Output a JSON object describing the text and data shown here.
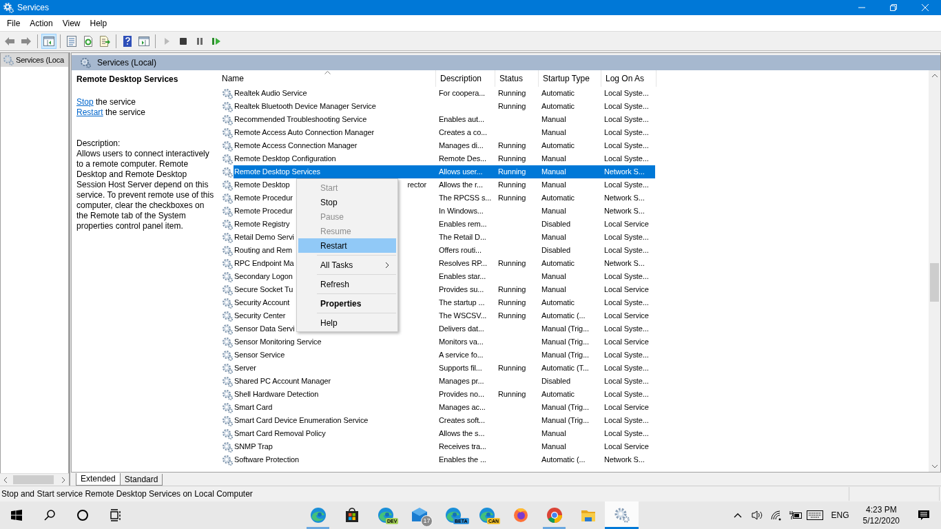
{
  "window": {
    "title": "Services"
  },
  "menu": [
    "File",
    "Action",
    "View",
    "Help"
  ],
  "toolbar": [
    {
      "kind": "back",
      "disabled": false,
      "pressed": false
    },
    {
      "kind": "forward",
      "disabled": false,
      "pressed": false
    },
    {
      "kind": "sep"
    },
    {
      "kind": "tree",
      "disabled": false,
      "pressed": true
    },
    {
      "kind": "sep"
    },
    {
      "kind": "props",
      "disabled": false,
      "pressed": false
    },
    {
      "kind": "refresh",
      "disabled": false,
      "pressed": false
    },
    {
      "kind": "export",
      "disabled": false,
      "pressed": false
    },
    {
      "kind": "sep"
    },
    {
      "kind": "help",
      "disabled": false,
      "pressed": false
    },
    {
      "kind": "pane",
      "disabled": false,
      "pressed": false
    },
    {
      "kind": "sep"
    },
    {
      "kind": "play",
      "disabled": true,
      "pressed": false
    },
    {
      "kind": "stop",
      "disabled": false,
      "pressed": false
    },
    {
      "kind": "pause",
      "disabled": false,
      "pressed": false
    },
    {
      "kind": "resume",
      "disabled": false,
      "pressed": false
    }
  ],
  "tree": {
    "items": [
      {
        "label": "Services (Loca",
        "selected": true
      }
    ]
  },
  "pane_header": "Services (Local)",
  "details": {
    "title": "Remote Desktop Services",
    "actions": [
      {
        "link": "Stop",
        "text": "the service"
      },
      {
        "link": "Restart",
        "text": "the service"
      }
    ],
    "description_label": "Description:",
    "description": "Allows users to connect interactively to a remote computer. Remote Desktop and Remote Desktop Session Host Server depend on this service. To prevent remote use of this computer, clear the checkboxes on the Remote tab of the System properties control panel item."
  },
  "table": {
    "columns": [
      "Name",
      "Description",
      "Status",
      "Startup Type",
      "Log On As"
    ],
    "rows": [
      {
        "name": "Realtek Audio Service",
        "description": "For coopera...",
        "status": "Running",
        "startup": "Automatic",
        "logon": "Local Syste...",
        "selected": false
      },
      {
        "name": "Realtek Bluetooth Device Manager Service",
        "status": "Running",
        "startup": "Automatic",
        "logon": "Local Syste...",
        "selected": false
      },
      {
        "name": "Recommended Troubleshooting Service",
        "description": "Enables aut...",
        "startup": "Manual",
        "logon": "Local Syste...",
        "selected": false
      },
      {
        "name": "Remote Access Auto Connection Manager",
        "description": "Creates a co...",
        "startup": "Manual",
        "logon": "Local Syste...",
        "selected": false
      },
      {
        "name": "Remote Access Connection Manager",
        "description": "Manages di...",
        "status": "Running",
        "startup": "Automatic",
        "logon": "Local Syste...",
        "selected": false
      },
      {
        "name": "Remote Desktop Configuration",
        "description": "Remote Des...",
        "status": "Running",
        "startup": "Manual",
        "logon": "Local Syste...",
        "selected": false
      },
      {
        "name": "Remote Desktop Services",
        "description": "Allows user...",
        "status": "Running",
        "startup": "Manual",
        "logon": "Network S...",
        "selected": true
      },
      {
        "name": "Remote Desktop",
        "name_tail": "rector",
        "description": "Allows the r...",
        "status": "Running",
        "startup": "Manual",
        "logon": "Local Syste...",
        "selected": false
      },
      {
        "name": "Remote Procedur",
        "description": "The RPCSS s...",
        "status": "Running",
        "startup": "Automatic",
        "logon": "Network S...",
        "selected": false
      },
      {
        "name": "Remote Procedur",
        "description": "In Windows...",
        "startup": "Manual",
        "logon": "Network S...",
        "selected": false
      },
      {
        "name": "Remote Registry",
        "description": "Enables rem...",
        "startup": "Disabled",
        "logon": "Local Service",
        "selected": false
      },
      {
        "name": "Retail Demo Servi",
        "description": "The Retail D...",
        "startup": "Manual",
        "logon": "Local Syste...",
        "selected": false
      },
      {
        "name": "Routing and Rem",
        "description": "Offers routi...",
        "startup": "Disabled",
        "logon": "Local Syste...",
        "selected": false
      },
      {
        "name": "RPC Endpoint Ma",
        "description": "Resolves RP...",
        "status": "Running",
        "startup": "Automatic",
        "logon": "Network S...",
        "selected": false
      },
      {
        "name": "Secondary Logon",
        "description": "Enables star...",
        "startup": "Manual",
        "logon": "Local Syste...",
        "selected": false
      },
      {
        "name": "Secure Socket Tu",
        "description": "Provides su...",
        "status": "Running",
        "startup": "Manual",
        "logon": "Local Service",
        "selected": false
      },
      {
        "name": "Security Account",
        "description": "The startup ...",
        "status": "Running",
        "startup": "Automatic",
        "logon": "Local Syste...",
        "selected": false
      },
      {
        "name": "Security Center",
        "description": "The WSCSV...",
        "status": "Running",
        "startup": "Automatic (...",
        "logon": "Local Service",
        "selected": false
      },
      {
        "name": "Sensor Data Servi",
        "description": "Delivers dat...",
        "startup": "Manual (Trig...",
        "logon": "Local Syste...",
        "selected": false
      },
      {
        "name": "Sensor Monitoring Service",
        "description": "Monitors va...",
        "startup": "Manual (Trig...",
        "logon": "Local Service",
        "selected": false
      },
      {
        "name": "Sensor Service",
        "description": "A service fo...",
        "startup": "Manual (Trig...",
        "logon": "Local Syste...",
        "selected": false
      },
      {
        "name": "Server",
        "description": "Supports fil...",
        "status": "Running",
        "startup": "Automatic (T...",
        "logon": "Local Syste...",
        "selected": false
      },
      {
        "name": "Shared PC Account Manager",
        "description": "Manages pr...",
        "startup": "Disabled",
        "logon": "Local Syste...",
        "selected": false
      },
      {
        "name": "Shell Hardware Detection",
        "description": "Provides no...",
        "status": "Running",
        "startup": "Automatic",
        "logon": "Local Syste...",
        "selected": false
      },
      {
        "name": "Smart Card",
        "description": "Manages ac...",
        "startup": "Manual (Trig...",
        "logon": "Local Service",
        "selected": false
      },
      {
        "name": "Smart Card Device Enumeration Service",
        "description": "Creates soft...",
        "startup": "Manual (Trig...",
        "logon": "Local Syste...",
        "selected": false
      },
      {
        "name": "Smart Card Removal Policy",
        "description": "Allows the s...",
        "startup": "Manual",
        "logon": "Local Syste...",
        "selected": false
      },
      {
        "name": "SNMP Trap",
        "description": "Receives tra...",
        "startup": "Manual",
        "logon": "Local Service",
        "selected": false
      },
      {
        "name": "Software Protection",
        "description": "Enables the ...",
        "startup": "Automatic (...",
        "logon": "Network S...",
        "selected": false
      }
    ]
  },
  "context_menu": [
    {
      "kind": "item",
      "label": "Start",
      "disabled": true,
      "selected": false,
      "bold": false
    },
    {
      "kind": "item",
      "label": "Stop",
      "disabled": false,
      "selected": false,
      "bold": false
    },
    {
      "kind": "item",
      "label": "Pause",
      "disabled": true,
      "selected": false,
      "bold": false
    },
    {
      "kind": "item",
      "label": "Resume",
      "disabled": true,
      "selected": false,
      "bold": false
    },
    {
      "kind": "item",
      "label": "Restart",
      "disabled": false,
      "selected": true,
      "bold": false
    },
    {
      "kind": "separator"
    },
    {
      "kind": "submenu",
      "label": "All Tasks",
      "disabled": false,
      "selected": false,
      "bold": false
    },
    {
      "kind": "separator"
    },
    {
      "kind": "item",
      "label": "Refresh",
      "disabled": false,
      "selected": false,
      "bold": false
    },
    {
      "kind": "separator"
    },
    {
      "kind": "item",
      "label": "Properties",
      "disabled": false,
      "selected": false,
      "bold": true
    },
    {
      "kind": "separator"
    },
    {
      "kind": "item",
      "label": "Help",
      "disabled": false,
      "selected": false,
      "bold": false
    }
  ],
  "view_tabs": [
    {
      "label": "Extended",
      "selected": true
    },
    {
      "label": "Standard",
      "selected": false
    }
  ],
  "status_bar": "Stop and Start service Remote Desktop Services on Local Computer",
  "taskbar": {
    "apps": [
      {
        "kind": "edge",
        "running": true,
        "active": false
      },
      {
        "kind": "store",
        "running": false,
        "active": false
      },
      {
        "kind": "edge",
        "badge": "DEV",
        "color": "#a4d05a",
        "running": false,
        "active": false
      },
      {
        "kind": "mail",
        "badge": "17",
        "running": false,
        "active": false
      },
      {
        "kind": "edge",
        "badge": "BETA",
        "color": "#2f8fd8",
        "running": false,
        "active": false
      },
      {
        "kind": "edge",
        "badge": "CAN",
        "color": "#f2c12e",
        "running": false,
        "active": false
      },
      {
        "kind": "firefox",
        "running": false,
        "active": false
      },
      {
        "kind": "chrome",
        "running": true,
        "active": false
      },
      {
        "kind": "explorer",
        "running": false,
        "active": false
      },
      {
        "kind": "services",
        "running": true,
        "active": true
      }
    ],
    "language": "ENG",
    "time": "4:23 PM",
    "date": "5/12/2020"
  }
}
